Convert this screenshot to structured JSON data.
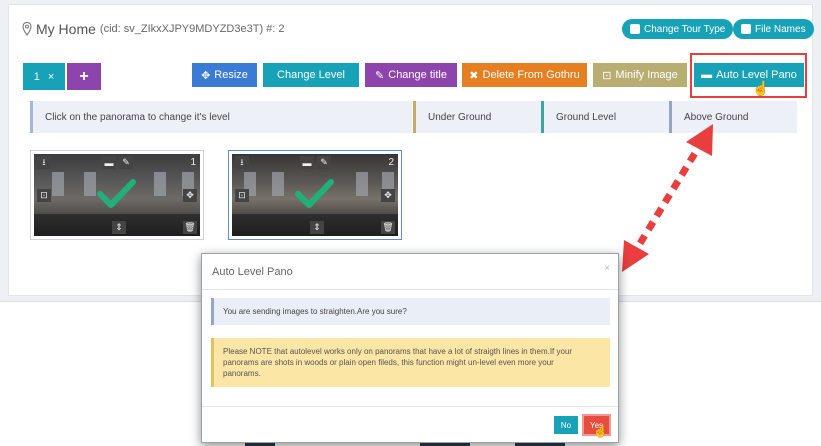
{
  "header": {
    "title": "My Home",
    "cid": "(cid: sv_ZIkxXJPY9MDYZD3e3T) #: 2",
    "change_tour_type": "Change Tour Type",
    "file_names": "File Names"
  },
  "tabs": {
    "active_label": "1",
    "close_glyph": "×",
    "add_glyph": "+"
  },
  "toolbar": {
    "resize": "Resize",
    "change_level": "Change Level",
    "change_title": "Change title",
    "delete": "Delete From Gothru",
    "minify": "Minify Image",
    "auto_level": "Auto Level Pano"
  },
  "levels": {
    "hint": "Click on the panorama to change it's level",
    "under": "Under Ground",
    "ground": "Ground Level",
    "above": "Above Ground"
  },
  "panoramas": [
    {
      "number": "1"
    },
    {
      "number": "2"
    }
  ],
  "modal": {
    "title": "Auto Level Pano",
    "close": "×",
    "info": "You are sending images to straighten.Are you sure?",
    "warning_1": "Please NOTE that autolevel works only on panorams that have a lot of straigth lines in them.If your",
    "warning_2": "panorams are shots in woods or plain open fileds, this function might un-level even more your",
    "warning_3": "panorams.",
    "no": "No",
    "yes": "Yes"
  },
  "colors": {
    "teal": "#17a2b8",
    "purple": "#8e44ad",
    "orange": "#e67e22",
    "khaki": "#b8ad73",
    "blue": "#3a7bd5",
    "red": "#e83e3e",
    "check": "#22b07a"
  }
}
